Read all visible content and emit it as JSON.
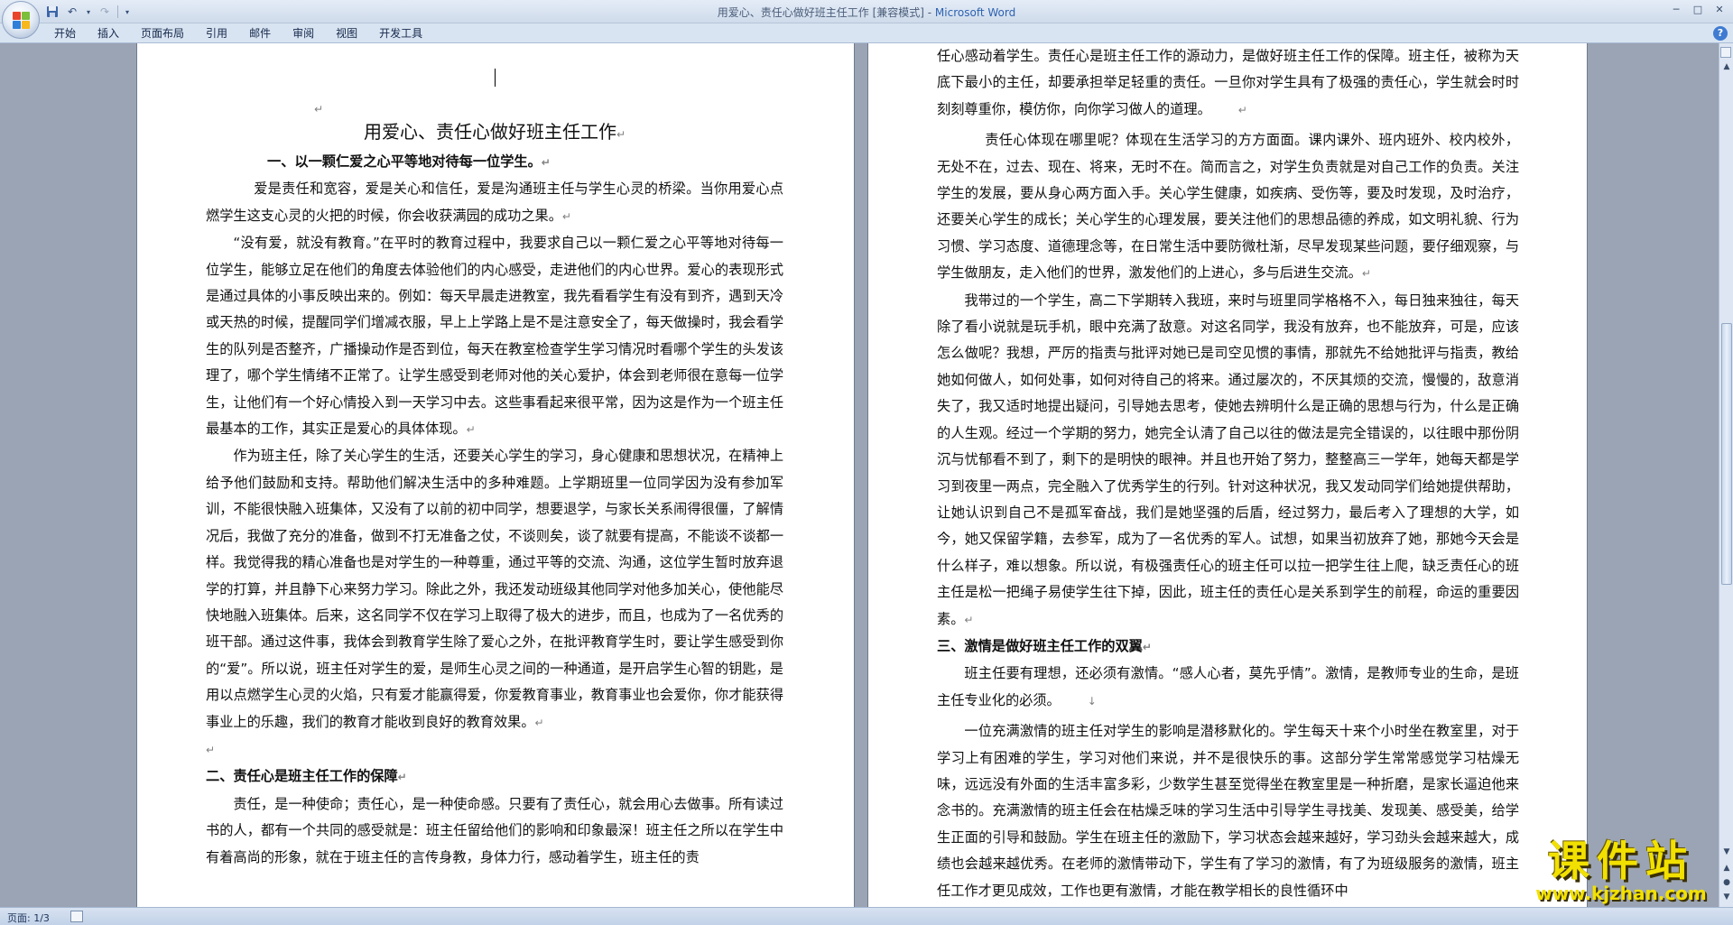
{
  "window": {
    "title_doc": "用爱心、责任心做好班主任工作 [兼容模式] - ",
    "title_app": "Microsoft Word"
  },
  "ribbon": {
    "tabs": [
      "开始",
      "插入",
      "页面布局",
      "引用",
      "邮件",
      "审阅",
      "视图",
      "开发工具"
    ]
  },
  "status": {
    "page": "页面: 1/3"
  },
  "watermark": {
    "main": "课件站",
    "url": "www.kjzhan.com"
  },
  "page1": {
    "title": "用爱心、责任心做好班主任工作",
    "h1": "一、以一颗仁爱之心平等地对待每一位学生。",
    "p1": "爱是责任和宽容，爱是关心和信任，爱是沟通班主任与学生心灵的桥梁。当你用爱心点燃学生这支心灵的火把的时候，你会收获满园的成功之果。",
    "p2": "“没有爱，就没有教育。”在平时的教育过程中，我要求自己以一颗仁爱之心平等地对待每一位学生，能够立足在他们的角度去体验他们的内心感受，走进他们的内心世界。爱心的表现形式是通过具体的小事反映出来的。例如：每天早晨走进教室，我先看看学生有没有到齐，遇到天冷或天热的时候，提醒同学们增减衣服，早上上学路上是不是注意安全了，每天做操时，我会看学生的队列是否整齐，广播操动作是否到位，每天在教室检查学生学习情况时看哪个学生的头发该理了，哪个学生情绪不正常了。让学生感受到老师对他的关心爱护，体会到老师很在意每一位学生，让他们有一个好心情投入到一天学习中去。这些事看起来很平常，因为这是作为一个班主任最基本的工作，其实正是爱心的具体体现。",
    "p3": "作为班主任，除了关心学生的生活，还要关心学生的学习，身心健康和思想状况，在精神上给予他们鼓励和支持。帮助他们解决生活中的多种难题。上学期班里一位同学因为没有参加军训，不能很快融入班集体，又没有了以前的初中同学，想要退学，与家长关系闹得很僵，了解情况后，我做了充分的准备，做到不打无准备之仗，不谈则矣，谈了就要有提高，不能谈不谈都一样。我觉得我的精心准备也是对学生的一种尊重，通过平等的交流、沟通，这位学生暂时放弃退学的打算，并且静下心来努力学习。除此之外，我还发动班级其他同学对他多加关心，使他能尽快地融入班集体。后来，这名同学不仅在学习上取得了极大的进步，而且，也成为了一名优秀的班干部。通过这件事，我体会到教育学生除了爱心之外，在批评教育学生时，要让学生感受到你的“爱”。所以说，班主任对学生的爱，是师生心灵之间的一种通道，是开启学生心智的钥匙，是用以点燃学生心灵的火焰，只有爱才能赢得爱，你爱教育事业，教育事业也会爱你，你才能获得事业上的乐趣，我们的教育才能收到良好的教育效果。",
    "h2": "二、责任心是班主任工作的保障",
    "p4": "责任，是一种使命；责任心，是一种使命感。只要有了责任心，就会用心去做事。所有读过书的人，都有一个共同的感受就是：班主任留给他们的影响和印象最深！班主任之所以在学生中有着高尚的形象，就在于班主任的言传身教，身体力行，感动着学生，班主任的责"
  },
  "page2": {
    "p1": "任心感动着学生。责任心是班主任工作的源动力，是做好班主任工作的保障。班主任，被称为天底下最小的主任，却要承担举足轻重的责任。一旦你对学生具有了极强的责任心，学生就会时时刻刻尊重你，模仿你，向你学习做人的道理。",
    "p2": "责任心体现在哪里呢？体现在生活学习的方方面面。课内课外、班内班外、校内校外，无处不在，过去、现在、将来，无时不在。简而言之，对学生负责就是对自己工作的负责。关注学生的发展，要从身心两方面入手。关心学生健康，如疾病、受伤等，要及时发现，及时治疗，还要关心学生的成长；关心学生的心理发展，要关注他们的思想品德的养成，如文明礼貌、行为习惯、学习态度、道德理念等，在日常生活中要防微杜渐，尽早发现某些问题，要仔细观察，与学生做朋友，走入他们的世界，激发他们的上进心，多与后进生交流。",
    "p3": "我带过的一个学生，高二下学期转入我班，来时与班里同学格格不入，每日独来独往，每天除了看小说就是玩手机，眼中充满了敌意。对这名同学，我没有放弃，也不能放弃，可是，应该怎么做呢？我想，严厉的指责与批评对她已是司空见惯的事情，那就先不给她批评与指责，教给她如何做人，如何处事，如何对待自己的将来。通过屡次的，不厌其烦的交流，慢慢的，敌意消失了，我又适时地提出疑问，引导她去思考，使她去辨明什么是正确的思想与行为，什么是正确的人生观。经过一个学期的努力，她完全认清了自己以往的做法是完全错误的，以往眼中那份阴沉与忧郁看不到了，剩下的是明快的眼神。并且也开始了努力，整整高三一学年，她每天都是学习到夜里一两点，完全融入了优秀学生的行列。针对这种状况，我又发动同学们给她提供帮助，让她认识到自己不是孤军奋战，我们是她坚强的后盾，经过努力，最后考入了理想的大学，如今，她又保留学籍，去参军，成为了一名优秀的军人。试想，如果当初放弃了她，那她今天会是什么样子，难以想象。所以说，有极强责任心的班主任可以拉一把学生往上爬，缺乏责任心的班主任是松一把绳子易使学生往下掉，因此，班主任的责任心是关系到学生的前程，命运的重要因素。",
    "h3": "三、激情是做好班主任工作的双翼",
    "p4": "班主任要有理想，还必须有激情。“感人心者，莫先乎情”。激情，是教师专业的生命，是班主任专业化的必须。",
    "p5": "一位充满激情的班主任对学生的影响是潜移默化的。学生每天十来个小时坐在教室里，对于学习上有困难的学生，学习对他们来说，并不是很快乐的事。这部分学生常常感觉学习枯燥无味，远远没有外面的生活丰富多彩，少数学生甚至觉得坐在教室里是一种折磨，是家长逼迫他来念书的。充满激情的班主任会在枯燥乏味的学习生活中引导学生寻找美、发现美、感受美，给学生正面的引导和鼓励。学生在班主任的激励下，学习状态会越来越好，学习劲头会越来越大，成绩也会越来越优秀。在老师的激情带动下，学生有了学习的激情，有了为班级服务的激情，班主任工作才更见成效，工作也更有激情，才能在教学相长的良性循环中"
  }
}
